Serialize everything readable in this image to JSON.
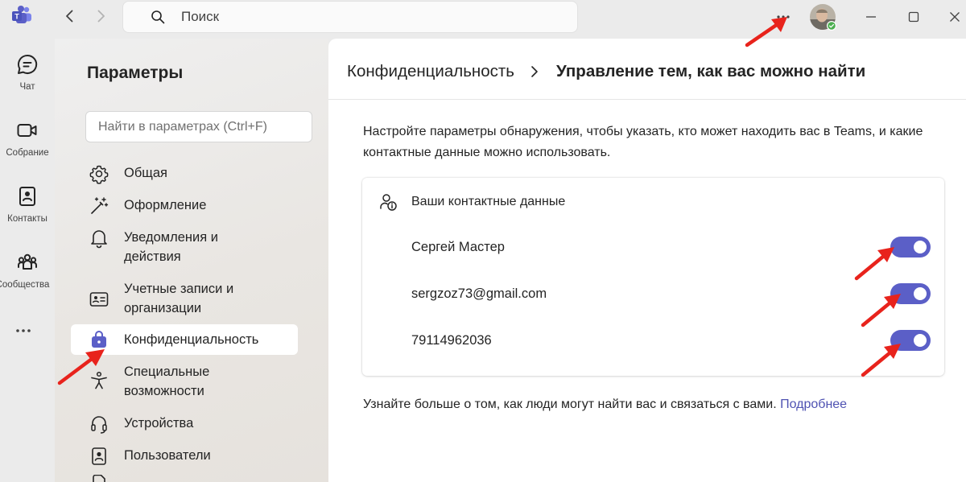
{
  "app": {
    "brand_color": "#5b5fc7",
    "link_color": "#4f52b2",
    "annotation_color": "#e8231c"
  },
  "rail": {
    "items": [
      {
        "label": "Чат",
        "icon": "chat-icon"
      },
      {
        "label": "Собрание",
        "icon": "video-camera-icon"
      },
      {
        "label": "Контакты",
        "icon": "contacts-book-icon"
      },
      {
        "label": "Сообщества",
        "icon": "communities-icon"
      }
    ],
    "more_icon": "more-horizontal-icon"
  },
  "titlebar": {
    "search_placeholder": "Поиск",
    "more_icon": "more-horizontal-icon",
    "presence": "available"
  },
  "settings": {
    "title": "Параметры",
    "search_placeholder": "Найти в параметрах (Ctrl+F)",
    "items": [
      {
        "label": "Общая",
        "icon": "gear-icon"
      },
      {
        "label": "Оформление",
        "icon": "magic-wand-icon"
      },
      {
        "label": "Уведомления и действия",
        "icon": "bell-icon"
      },
      {
        "label": "Учетные записи и организации",
        "icon": "id-card-icon"
      },
      {
        "label": "Конфиденциальность",
        "icon": "lock-bag-icon",
        "active": true
      },
      {
        "label": "Специальные возможности",
        "icon": "accessibility-icon"
      },
      {
        "label": "Устройства",
        "icon": "headset-icon"
      },
      {
        "label": "Пользователи",
        "icon": "contacts-icon"
      }
    ]
  },
  "content": {
    "breadcrumb_parent": "Конфиденциальность",
    "breadcrumb_current": "Управление тем, как вас можно найти",
    "description": "Настройте параметры обнаружения, чтобы указать, кто может находить вас в Teams, и какие контактные данные можно использовать.",
    "card": {
      "header": "Ваши контактные данные",
      "rows": [
        {
          "label": "Сергей Мастер",
          "enabled": true
        },
        {
          "label": "sergzoz73@gmail.com",
          "enabled": true
        },
        {
          "label": "79114962036",
          "enabled": true
        }
      ]
    },
    "learn_more_text": "Узнайте больше о том, как люди могут найти вас и связаться с вами.",
    "learn_more_link": "Подробнее"
  }
}
